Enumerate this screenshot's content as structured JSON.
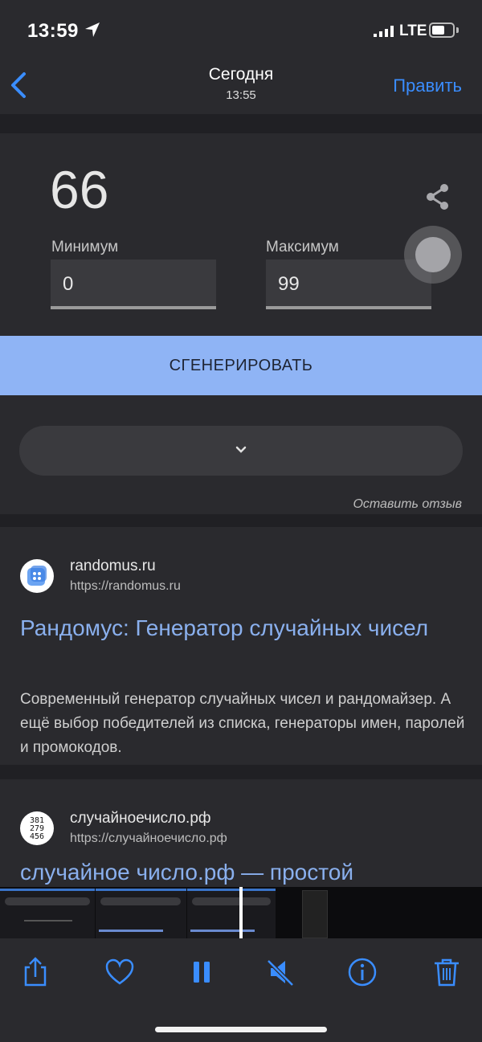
{
  "status_bar": {
    "time": "13:59",
    "network": "LTE"
  },
  "nav": {
    "back_icon": "chevron-left-icon",
    "title": "Сегодня",
    "subtitle": "13:55",
    "edit_label": "Править"
  },
  "generator": {
    "result": "66",
    "min_label": "Минимум",
    "min_value": "0",
    "max_label": "Максимум",
    "max_value": "99",
    "generate_label": "СГЕНЕРИРОВАТЬ",
    "feedback_label": "Оставить отзыв"
  },
  "results": [
    {
      "site": "randomus.ru",
      "url": "https://randomus.ru",
      "title": "Рандомус: Генератор случайных чисел",
      "snippet": "Современный генератор случайных чисел и рандомайзер. А ещё выбор победителей из списка, генераторы имен, паролей и промокодов."
    },
    {
      "site": "случайноечисло.рф",
      "url": "https://случайноечисло.рф",
      "title": "случайное число.рф — простой",
      "favicon_digits": "381 279 456"
    }
  ],
  "toolbar": {
    "icons": [
      "share-icon",
      "heart-icon",
      "pause-icon",
      "mute-icon",
      "info-icon",
      "trash-icon"
    ]
  },
  "colors": {
    "accent": "#3a8dff",
    "link": "#8ab0ee",
    "button": "#8fb4f5"
  }
}
